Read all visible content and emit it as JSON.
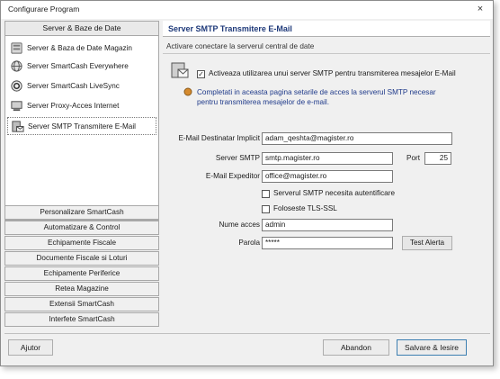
{
  "window": {
    "title": "Configurare Program",
    "close_glyph": "×"
  },
  "leftnav": {
    "header": "Server & Baze de Date",
    "items": [
      {
        "label": "Server & Baza de Date Magazin",
        "icon": "server-icon"
      },
      {
        "label": "Server SmartCash Everywhere",
        "icon": "globe-icon"
      },
      {
        "label": "Server SmartCash LiveSync",
        "icon": "sync-icon"
      },
      {
        "label": "Server Proxy-Acces Internet",
        "icon": "computer-icon"
      },
      {
        "label": "Server SMTP Transmitere E-Mail",
        "icon": "mail-server-icon",
        "active": true
      }
    ],
    "buttons": [
      "Personalizare SmartCash",
      "Automatizare & Control",
      "Echipamente Fiscale",
      "Documente Fiscale si Loturi",
      "Echipamente Periferice",
      "Retea Magazine",
      "Extensii SmartCash",
      "Interfete SmartCash"
    ]
  },
  "content": {
    "title": "Server SMTP Transmitere E-Mail",
    "section_label": "Activare conectare la serverul central de date",
    "enable_checkbox": {
      "checked": true,
      "check_glyph": "✓",
      "label": "Activeaza utilizarea unui server SMTP pentru transmiterea mesajelor E-Mail"
    },
    "info_text_1": "Completati in aceasta pagina setarile de acces la serverul SMTP necesar",
    "info_text_2": "pentru transmiterea mesajelor de e-mail.",
    "fields": {
      "email_dest_label": "E-Mail Destinatar Implicit",
      "email_dest_value": "adam_qeshta@magister.ro",
      "server_label": "Server SMTP",
      "server_value": "smtp.magister.ro",
      "port_label": "Port",
      "port_value": "25",
      "email_from_label": "E-Mail Expeditor",
      "email_from_value": "office@magister.ro",
      "auth_label": "Serverul SMTP necesita autentificare",
      "tls_label": "Foloseste TLS-SSL",
      "user_label": "Nume acces",
      "user_value": "admin",
      "pass_label": "Parola",
      "pass_value": "*****",
      "test_button": "Test Alerta"
    }
  },
  "footer": {
    "help": "Ajutor",
    "cancel": "Abandon",
    "save": "Salvare & Iesire"
  }
}
